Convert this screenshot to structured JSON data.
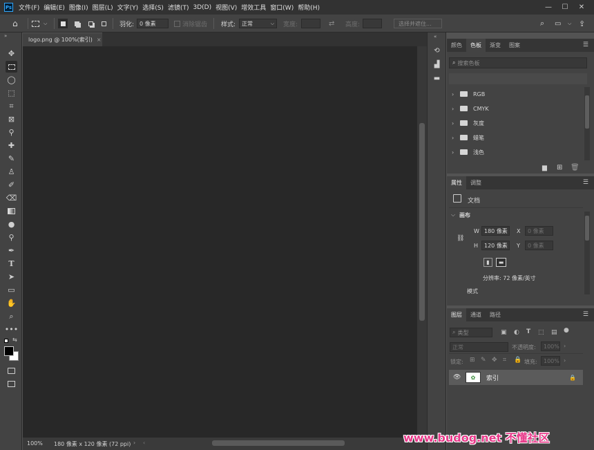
{
  "app": {
    "logo": "Ps"
  },
  "menu": [
    "文件(F)",
    "编辑(E)",
    "图像(I)",
    "图层(L)",
    "文字(Y)",
    "选择(S)",
    "滤镜(T)",
    "3D(D)",
    "视图(V)",
    "增效工具",
    "窗口(W)",
    "帮助(H)"
  ],
  "window_controls": [
    "—",
    "☐",
    "✕"
  ],
  "options": {
    "feather_label": "羽化:",
    "feather_value": "0 像素",
    "antialias_label": "消除锯齿",
    "style_label": "样式:",
    "style_value": "正常",
    "width_label": "宽度:",
    "height_label": "高度:",
    "select_subject": "选择并遮住..."
  },
  "document": {
    "tab_label": "logo.png @ 100%(索引)",
    "tab_close": "×",
    "zoom": "100%",
    "doc_info": "180 像素 x 120 像素 (72 ppi)"
  },
  "swatches_panel": {
    "tabs": [
      "颜色",
      "色板",
      "渐变",
      "图案"
    ],
    "active_tab": 1,
    "search_placeholder": "搜索色板",
    "groups": [
      "RGB",
      "CMYK",
      "灰度",
      "蜡笔",
      "浅色"
    ]
  },
  "properties_panel": {
    "tabs": [
      "属性",
      "调整"
    ],
    "doc_label": "文档",
    "canvas_section": "画布",
    "w_label": "W",
    "w_value": "180 像素",
    "h_label": "H",
    "h_value": "120 像素",
    "x_label": "X",
    "x_value": "0 像素",
    "y_label": "Y",
    "y_value": "0 像素",
    "resolution": "分辨率: 72 像素/英寸",
    "mode_label": "模式"
  },
  "layers_panel": {
    "tabs": [
      "图层",
      "通道",
      "路径"
    ],
    "filter_placeholder": "类型",
    "blend_mode": "正常",
    "opacity_label": "不透明度:",
    "opacity_value": "100%",
    "lock_label": "锁定:",
    "fill_label": "填充:",
    "fill_value": "100%",
    "layer_name": "索引"
  },
  "watermark": "www.budog.net 不懂社区"
}
